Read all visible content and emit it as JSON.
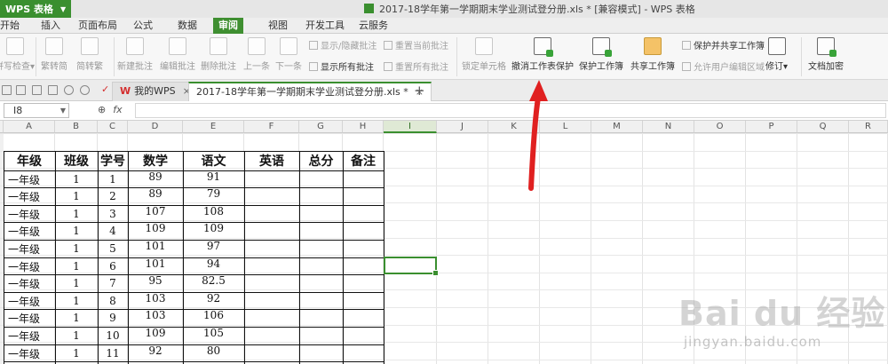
{
  "app": {
    "name": "WPS 表格",
    "window_title": "2017-18学年第一学期期末学业测试登分册.xls * [兼容模式] - WPS 表格"
  },
  "menu_tabs": [
    "开始",
    "插入",
    "页面布局",
    "公式",
    "数据",
    "审阅",
    "视图",
    "开发工具",
    "云服务"
  ],
  "active_menu_tab": "审阅",
  "ribbon": {
    "spell_check": "拼写检查",
    "trad_to_simp": "繁转简",
    "simp_to_trad": "简转繁",
    "new_comment": "新建批注",
    "edit_comment": "编辑批注",
    "delete_comment": "删除批注",
    "prev": "上一条",
    "next": "下一条",
    "show_hide_comment": "显示/隐藏批注",
    "reset_current_comment": "重置当前批注",
    "show_all_comments": "显示所有批注",
    "reset_all_comments": "重置所有批注",
    "lock_cell": "锁定单元格",
    "unprotect_sheet": "撤消工作表保护",
    "protect_workbook": "保护工作簿",
    "share_workbook": "共享工作簿",
    "protect_and_share": "保护并共享工作簿",
    "allow_edit_ranges": "允许用户编辑区域",
    "track_changes": "修订",
    "encrypt_document": "文档加密"
  },
  "doc_tabs": [
    {
      "label": "我的WPS"
    },
    {
      "label": "2017-18学年第一学期期末学业测试登分册.xls *"
    }
  ],
  "formula_bar": {
    "name_box": "I8",
    "fx": "fx"
  },
  "column_headers": [
    "A",
    "B",
    "C",
    "D",
    "E",
    "F",
    "G",
    "H",
    "I",
    "J",
    "K",
    "L",
    "M",
    "N",
    "O",
    "P",
    "Q",
    "R"
  ],
  "selected_column": "I",
  "table": {
    "headers": [
      "年级",
      "班级",
      "学号",
      "数学",
      "语文",
      "英语",
      "总分",
      "备注"
    ],
    "rows": [
      [
        "一年级",
        "1",
        "1",
        "89",
        "91"
      ],
      [
        "一年级",
        "1",
        "2",
        "89",
        "79"
      ],
      [
        "一年级",
        "1",
        "3",
        "107",
        "108"
      ],
      [
        "一年级",
        "1",
        "4",
        "109",
        "109"
      ],
      [
        "一年级",
        "1",
        "5",
        "101",
        "97"
      ],
      [
        "一年级",
        "1",
        "6",
        "101",
        "94"
      ],
      [
        "一年级",
        "1",
        "7",
        "95",
        "82.5"
      ],
      [
        "一年级",
        "1",
        "8",
        "103",
        "92"
      ],
      [
        "一年级",
        "1",
        "9",
        "103",
        "106"
      ],
      [
        "一年级",
        "1",
        "10",
        "109",
        "105"
      ],
      [
        "一年级",
        "1",
        "11",
        "92",
        "80"
      ]
    ]
  },
  "watermark": {
    "brand": "Bai du 经验",
    "url": "jingyan.baidu.com"
  },
  "colors": {
    "accent_green": "#3a8f2f",
    "arrow_red": "#e02020"
  }
}
